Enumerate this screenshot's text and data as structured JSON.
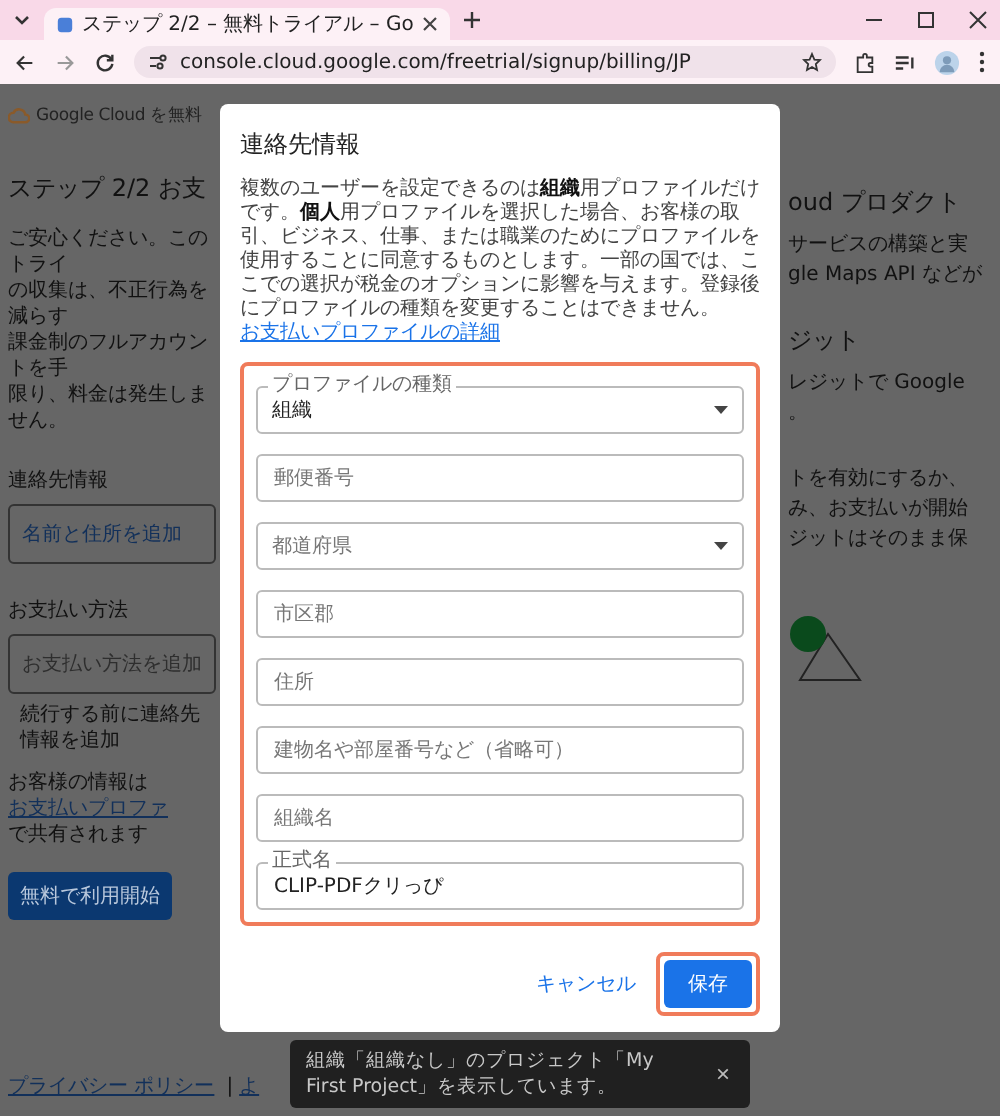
{
  "browser": {
    "tab_title": "ステップ 2/2 – 無料トライアル – Go",
    "tab_selected": true,
    "url": "console.cloud.google.com/freetrial/signup/billing/JP"
  },
  "page": {
    "brand": "Google Cloud を無料",
    "heading": "ステップ 2/2 お支",
    "intro_lines": [
      "ご安心ください。このトライ",
      "の収集は、不正行為を減らす",
      "課金制のフルアカウントを手",
      "限り、料金は発生しません。"
    ],
    "contact": {
      "label": "連絡先情報",
      "action": "名前と住所を追加"
    },
    "payment": {
      "label": "お支払い方法",
      "placeholder": "お支払い方法を追加",
      "hint": "続行する前に連絡先情報を追加"
    },
    "info": {
      "text": "お客様の情報は",
      "link": "お支払いプロファ",
      "text_2": "で共有されます"
    },
    "start_button": "無料で利用開始",
    "footer": {
      "link": "プライバシー ポリシー",
      "separator": "|",
      "cut": "よ"
    }
  },
  "side": {
    "heading_1": "oud プロダクト",
    "lines_1": [
      "サービスの構築と実",
      "gle Maps API などが"
    ],
    "heading_2": "ジット",
    "lines_2": [
      "レジットで Google",
      "。"
    ],
    "lines_3": [
      "トを有効にするか、",
      "み、お支払いが開始",
      "ジットはそのまま保"
    ]
  },
  "dialog": {
    "title": "連絡先情報",
    "description": "複数のユーザーを設定できるのは**組織**用プロファイルだけです。**個人**用プロファイルを選択した場合、お客様の取引、ビジネス、仕事、または職業のためにプロファイルを使用することに同意するものとします。一部の国では、ここでの選択が税金のオプションに影響を与えます。登録後にプロファイルの種類を変更することはできません。",
    "description_link": "お支払いプロファイルの詳細",
    "fields_highlighted": true,
    "fields": [
      {
        "kind": "select",
        "label": "プロファイルの種類",
        "value": "組織"
      },
      {
        "kind": "text",
        "placeholder": "郵便番号"
      },
      {
        "kind": "select",
        "placeholder": "都道府県"
      },
      {
        "kind": "text",
        "placeholder": "市区郡"
      },
      {
        "kind": "text",
        "placeholder": "住所"
      },
      {
        "kind": "text",
        "placeholder": "建物名や部屋番号など（省略可）"
      },
      {
        "kind": "text",
        "placeholder": "組織名"
      },
      {
        "kind": "text",
        "label": "正式名",
        "value": "CLIP-PDFクリっぴ"
      }
    ],
    "cancel": "キャンセル",
    "save": "保存",
    "save_highlighted": true
  },
  "toast": {
    "lines": [
      "組織「組織なし」のプロジェクト「My",
      "First Project」を表示しています。"
    ],
    "close": "×"
  }
}
